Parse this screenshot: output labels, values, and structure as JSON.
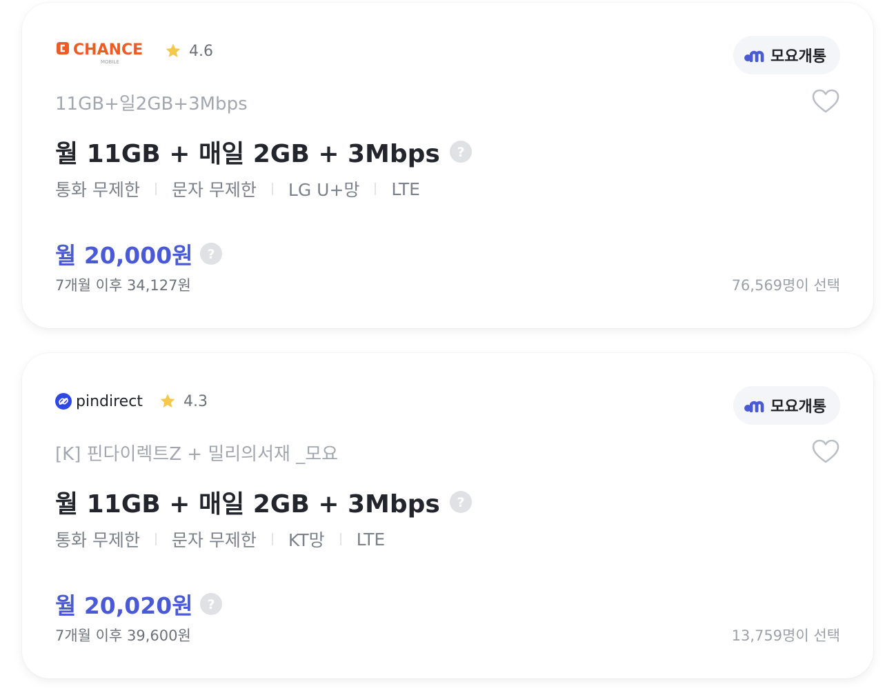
{
  "plans": [
    {
      "provider_logo_text": "CHANCE",
      "provider_logo_subtext": "MOBILE",
      "rating": "4.6",
      "badge_label": "모요개통",
      "plan_name": "11GB+일2GB+3Mbps",
      "title": "월 11GB + 매일 2GB + 3Mbps",
      "features": [
        "통화 무제한",
        "문자 무제한",
        "LG U+망",
        "LTE"
      ],
      "price": "월 20,000원",
      "after_price": "7개월 이후 34,127원",
      "selected_count": "76,569명이 선택"
    },
    {
      "provider_logo_text": "pindirect",
      "rating": "4.3",
      "badge_label": "모요개통",
      "plan_name": "[K] 핀다이렉트Z + 밀리의서재 _모요",
      "title": "월 11GB + 매일 2GB + 3Mbps",
      "features": [
        "통화 무제한",
        "문자 무제한",
        "KT망",
        "LTE"
      ],
      "price": "월 20,020원",
      "after_price": "7개월 이후 39,600원",
      "selected_count": "13,759명이 선택"
    }
  ],
  "icons": {
    "rating": "star-icon",
    "badge": "moyo-logo-icon",
    "favorite": "heart-icon",
    "help": "question-circle-icon"
  },
  "colors": {
    "price_accent": "#4a5ad6",
    "chance_brand": "#f05a24",
    "pindirect_brand": "#2f47e6",
    "star": "#f4c84a"
  }
}
